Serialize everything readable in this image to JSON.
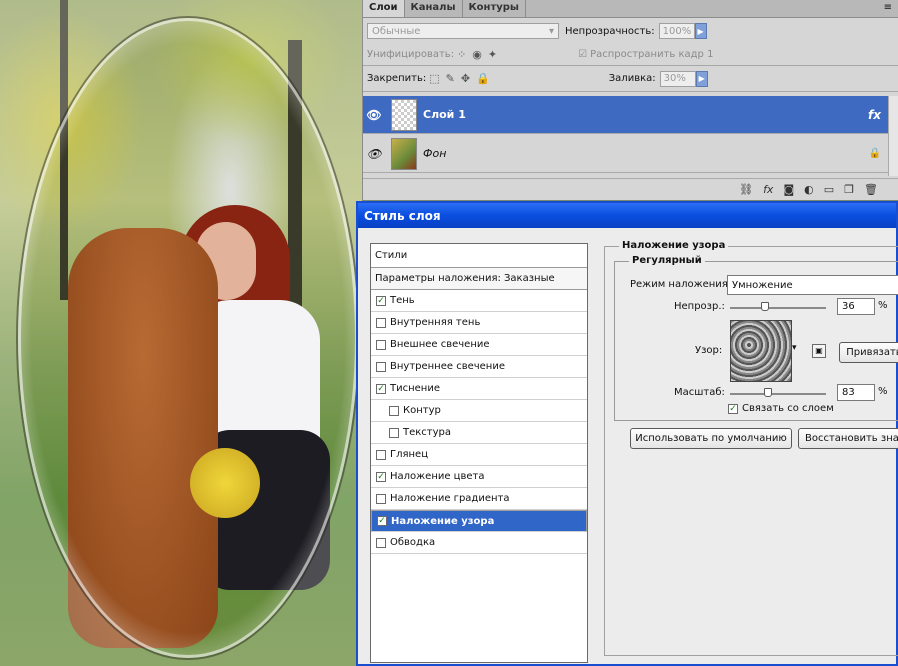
{
  "layers_panel": {
    "tabs": [
      "Слои",
      "Каналы",
      "Контуры"
    ],
    "menu_icon": "≡",
    "blend_mode": "Обычные",
    "opacity_label": "Непрозрачность:",
    "opacity_value": "100%",
    "unify_label": "Унифицировать:",
    "propagate_label": "Распространить кадр 1",
    "lock_label": "Закрепить:",
    "fill_label": "Заливка:",
    "fill_value": "30%",
    "layers": [
      {
        "name": "Слой 1",
        "right": "fx",
        "selected": true
      },
      {
        "name": "Фон",
        "right": "🔒",
        "selected": false
      }
    ],
    "bottom_icons": [
      "link-icon",
      "fx-icon",
      "mask-icon",
      "adjustment-icon",
      "folder-icon",
      "new-layer-icon",
      "trash-icon"
    ]
  },
  "dialog": {
    "title": "Стиль слоя",
    "styles_header": "Стили",
    "blend_params": "Параметры наложения: Заказные",
    "items": [
      {
        "label": "Тень",
        "checked": true,
        "indent": false,
        "selected": false
      },
      {
        "label": "Внутренняя тень",
        "checked": false,
        "indent": false,
        "selected": false
      },
      {
        "label": "Внешнее свечение",
        "checked": false,
        "indent": false,
        "selected": false
      },
      {
        "label": "Внутреннее свечение",
        "checked": false,
        "indent": false,
        "selected": false
      },
      {
        "label": "Тиснение",
        "checked": true,
        "indent": false,
        "selected": false
      },
      {
        "label": "Контур",
        "checked": false,
        "indent": true,
        "selected": false
      },
      {
        "label": "Текстура",
        "checked": false,
        "indent": true,
        "selected": false
      },
      {
        "label": "Глянец",
        "checked": false,
        "indent": false,
        "selected": false
      },
      {
        "label": "Наложение цвета",
        "checked": true,
        "indent": false,
        "selected": false
      },
      {
        "label": "Наложение градиента",
        "checked": false,
        "indent": false,
        "selected": false
      },
      {
        "label": "Наложение узора",
        "checked": true,
        "indent": false,
        "selected": true
      },
      {
        "label": "Обводка",
        "checked": false,
        "indent": false,
        "selected": false
      }
    ],
    "section_title": "Наложение узора",
    "subsection_title": "Регулярный",
    "blend_mode_label": "Режим наложения:",
    "blend_mode_value": "Умножение",
    "opacity_label": "Непрозр.:",
    "opacity_value": "36",
    "opacity_fraction": 0.36,
    "percent": "%",
    "pattern_label": "Узор:",
    "snap_button": "Привязать",
    "scale_label": "Масштаб:",
    "scale_value": "83",
    "scale_fraction": 0.4,
    "link_label": "Связать со слоем",
    "default_button": "Использовать по умолчанию",
    "reset_button": "Восстановить знач"
  }
}
